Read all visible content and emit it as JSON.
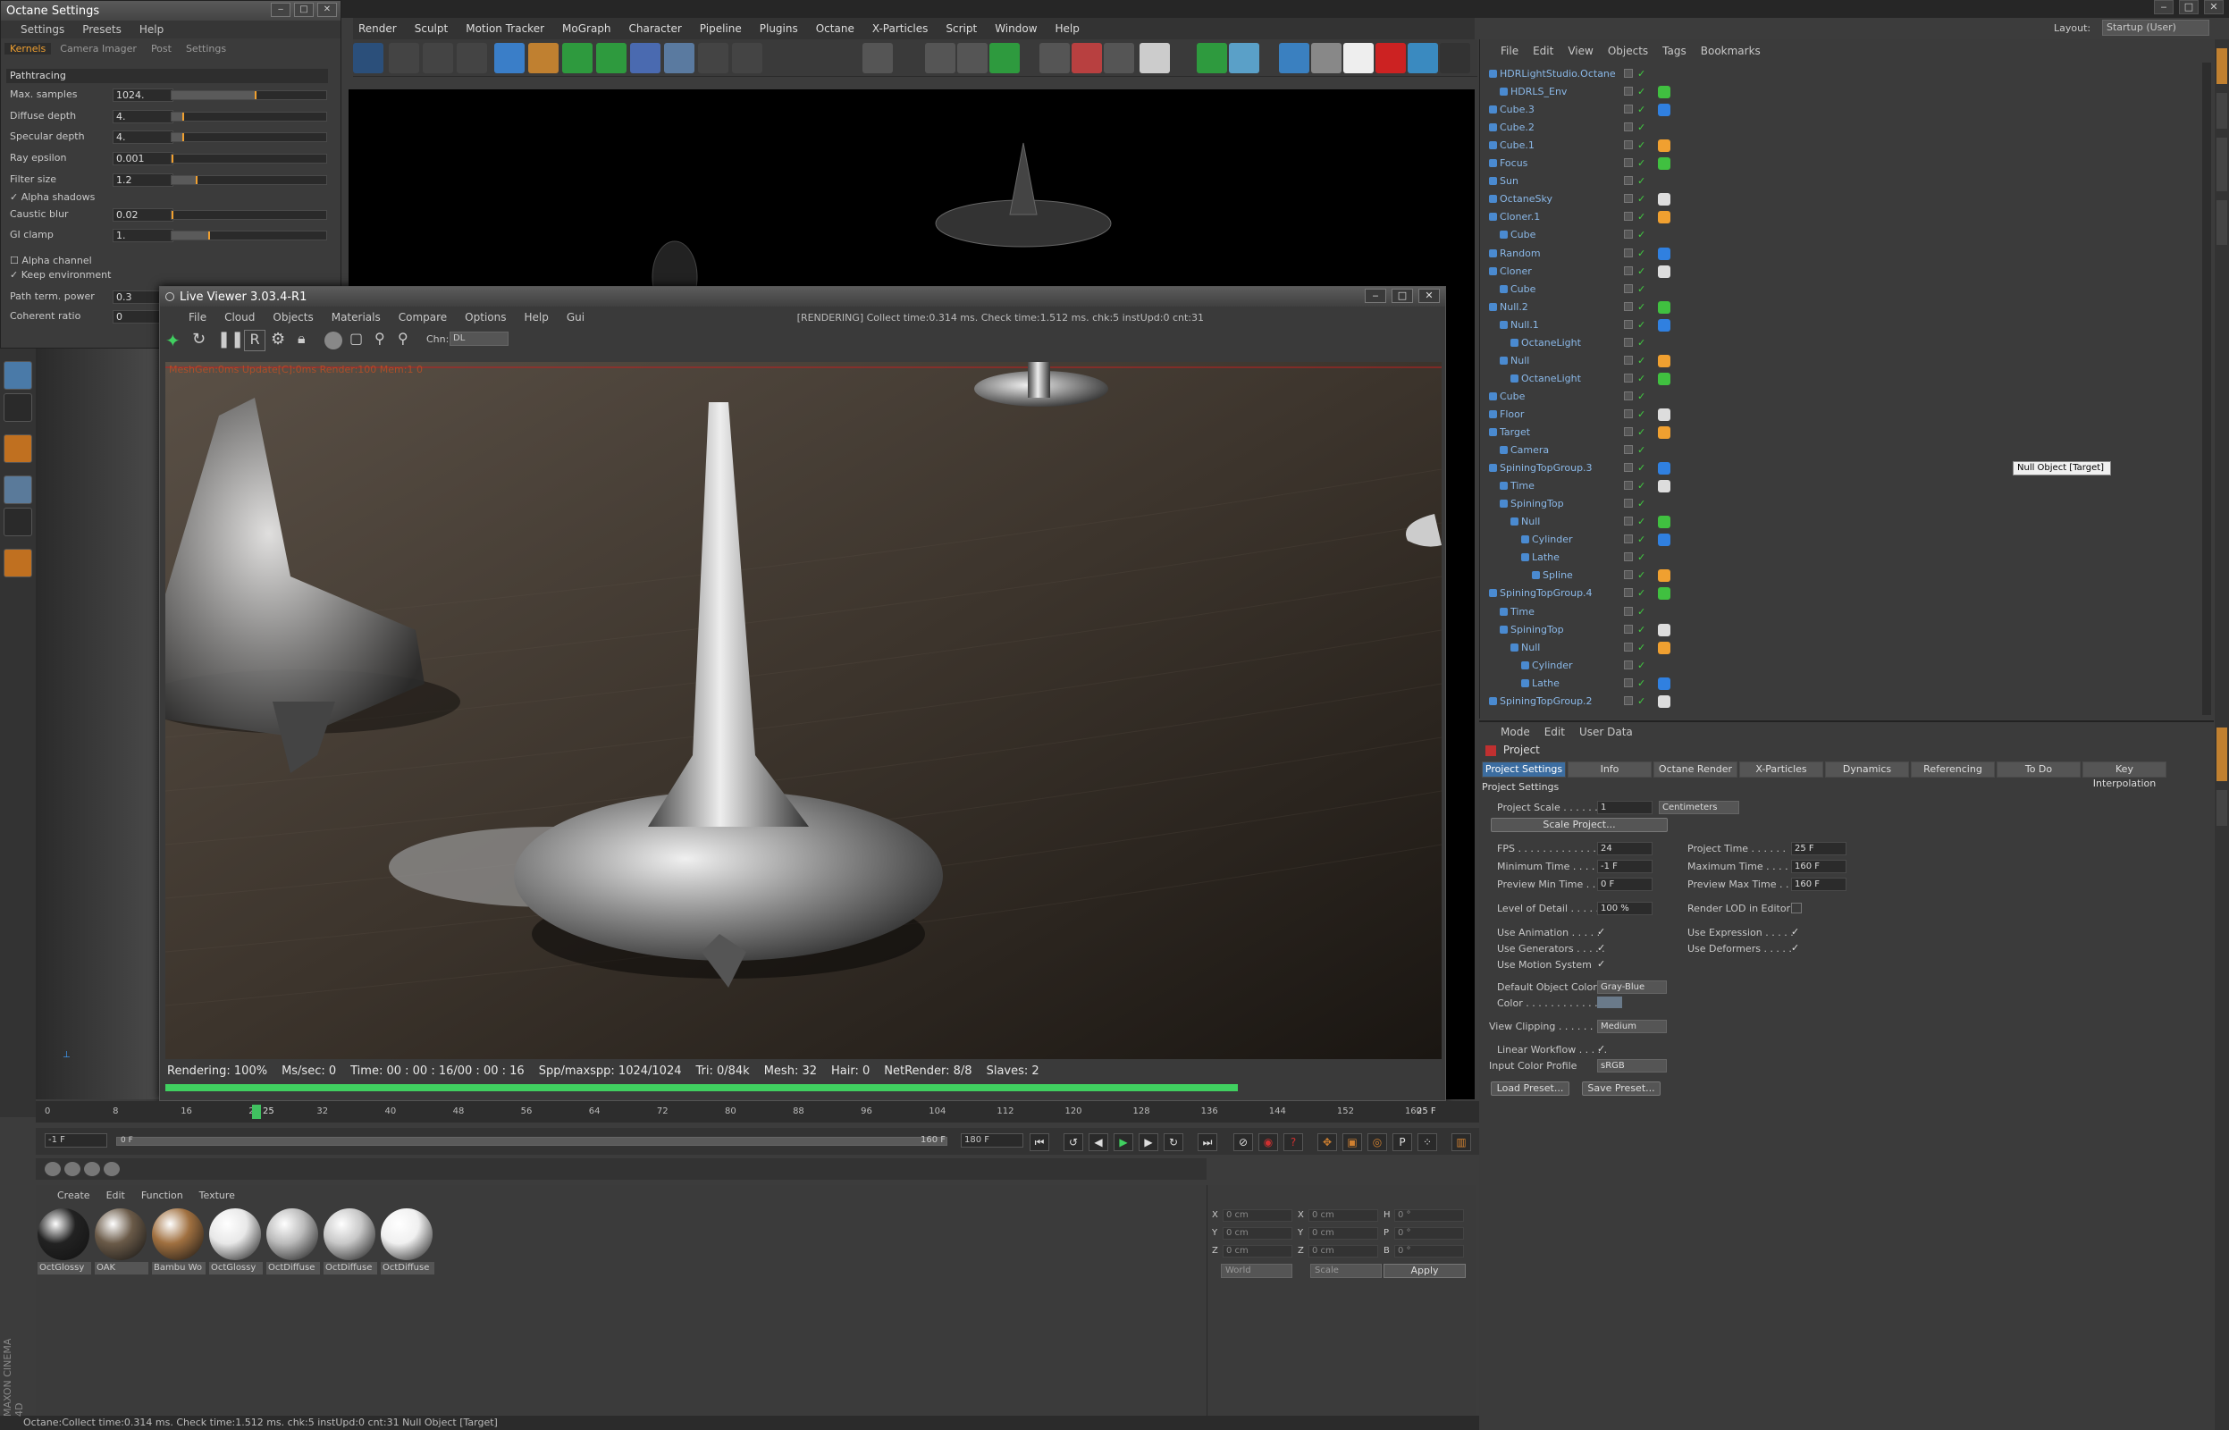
{
  "app": {
    "menu": [
      "Render",
      "Sculpt",
      "Motion Tracker",
      "MoGraph",
      "Character",
      "Pipeline",
      "Plugins",
      "Octane",
      "X-Particles",
      "Script",
      "Window",
      "Help"
    ],
    "layout_label": "Layout:",
    "layout_value": "Startup (User)",
    "status": "Octane:Collect time:0.314 ms.  Check time:1.512 ms.  chk:5  instUpd:0  cnt:31     Null Object [Target]",
    "brand": "MAXON CINEMA 4D"
  },
  "octane_settings": {
    "title": "Octane Settings",
    "menu": [
      "Settings",
      "Presets",
      "Help"
    ],
    "tabs": [
      "Kernels",
      "Camera Imager",
      "Post",
      "Settings"
    ],
    "mode": "Pathtracing",
    "params": [
      {
        "label": "Max. samples",
        "value": "1024.",
        "fill": 0.55
      },
      {
        "label": "Diffuse depth",
        "value": "4.",
        "fill": 0.08
      },
      {
        "label": "Specular depth",
        "value": "4.",
        "fill": 0.08
      },
      {
        "label": "Ray epsilon",
        "value": "0.001",
        "fill": 0.0
      },
      {
        "label": "Filter size",
        "value": "1.2",
        "fill": 0.17
      },
      {
        "label": "Caustic blur",
        "value": "0.02",
        "fill": 0.0
      },
      {
        "label": "GI clamp",
        "value": "1.",
        "fill": 0.25
      }
    ],
    "checks": [
      "Alpha shadows",
      "Alpha channel",
      "Keep environment"
    ],
    "path_term": {
      "label": "Path term. power",
      "value": "0.3"
    },
    "coherent": {
      "label": "Coherent ratio",
      "value": "0"
    }
  },
  "live_viewer": {
    "title": "Live Viewer 3.03.4-R1",
    "menu": [
      "File",
      "Cloud",
      "Objects",
      "Materials",
      "Compare",
      "Options",
      "Help",
      "Gui"
    ],
    "status": "[RENDERING] Collect time:0.314 ms.  Check time:1.512 ms.  chk:5  instUpd:0  cnt:31",
    "channel_label": "Chn:",
    "channel_value": "DL",
    "overlay": "MeshGen:0ms  Update[C]:0ms  Render:100  Mem:1  0",
    "stats": {
      "rendering": "Rendering: 100%",
      "mssec": "Ms/sec: 0",
      "time": "Time: 00 : 00 : 16/00 : 00 : 16",
      "spp": "Spp/maxspp: 1024/1024",
      "tri": "Tri: 0/84k",
      "mesh": "Mesh: 32",
      "hair": "Hair: 0",
      "netrender": "NetRender: 8/8",
      "slaves": "Slaves: 2"
    },
    "progress": 1.0
  },
  "timeline": {
    "ticks": [
      "0",
      "8",
      "16",
      "24",
      "32",
      "40",
      "48",
      "56",
      "64",
      "72",
      "80",
      "88",
      "96",
      "104",
      "112",
      "120",
      "128",
      "136",
      "144",
      "152",
      "160"
    ],
    "current_frame": "25",
    "frame_display": "25 F",
    "start_field": "-1 F",
    "range_start": "0 F",
    "range_end": "160 F",
    "end_field": "180 F"
  },
  "materials": {
    "menu": [
      "Create",
      "Edit",
      "Function",
      "Texture"
    ],
    "items": [
      {
        "name": "OctGlossy",
        "color": "#222"
      },
      {
        "name": "OAK",
        "color": "#6a5a48"
      },
      {
        "name": "Bambu Wo",
        "color": "#a07040"
      },
      {
        "name": "OctGlossy",
        "color": "#e8e8e8"
      },
      {
        "name": "OctDiffuse",
        "color": "#bbbbbb"
      },
      {
        "name": "OctDiffuse",
        "color": "#c8c8c8"
      },
      {
        "name": "OctDiffuse",
        "color": "#f0f0f0"
      }
    ]
  },
  "coords": {
    "rows": [
      {
        "a": "X",
        "av": "0 cm",
        "b": "X",
        "bv": "0 cm",
        "c": "H",
        "cv": "0 °"
      },
      {
        "a": "Y",
        "av": "0 cm",
        "b": "Y",
        "bv": "0 cm",
        "c": "P",
        "cv": "0 °"
      },
      {
        "a": "Z",
        "av": "0 cm",
        "b": "Z",
        "bv": "0 cm",
        "c": "B",
        "cv": "0 °"
      }
    ],
    "world": "World",
    "scale": "Scale",
    "apply": "Apply"
  },
  "object_manager": {
    "menu": [
      "File",
      "Edit",
      "View",
      "Objects",
      "Tags",
      "Bookmarks"
    ],
    "tooltip": "Null Object [Target]",
    "objects": [
      {
        "name": "HDRLightStudio.Octane",
        "depth": 0
      },
      {
        "name": "HDRLS_Env",
        "depth": 1
      },
      {
        "name": "Cube.3",
        "depth": 0
      },
      {
        "name": "Cube.2",
        "depth": 0
      },
      {
        "name": "Cube.1",
        "depth": 0
      },
      {
        "name": "Focus",
        "depth": 0
      },
      {
        "name": "Sun",
        "depth": 0
      },
      {
        "name": "OctaneSky",
        "depth": 0
      },
      {
        "name": "Cloner.1",
        "depth": 0
      },
      {
        "name": "Cube",
        "depth": 1
      },
      {
        "name": "Random",
        "depth": 0
      },
      {
        "name": "Cloner",
        "depth": 0
      },
      {
        "name": "Cube",
        "depth": 1
      },
      {
        "name": "Null.2",
        "depth": 0
      },
      {
        "name": "Null.1",
        "depth": 1
      },
      {
        "name": "OctaneLight",
        "depth": 2
      },
      {
        "name": "Null",
        "depth": 1
      },
      {
        "name": "OctaneLight",
        "depth": 2
      },
      {
        "name": "Cube",
        "depth": 0
      },
      {
        "name": "Floor",
        "depth": 0
      },
      {
        "name": "Target",
        "depth": 0
      },
      {
        "name": "Camera",
        "depth": 1
      },
      {
        "name": "SpiningTopGroup.3",
        "depth": 0
      },
      {
        "name": "Time",
        "depth": 1
      },
      {
        "name": "SpiningTop",
        "depth": 1
      },
      {
        "name": "Null",
        "depth": 2
      },
      {
        "name": "Cylinder",
        "depth": 3
      },
      {
        "name": "Lathe",
        "depth": 3
      },
      {
        "name": "Spline",
        "depth": 4
      },
      {
        "name": "SpiningTopGroup.4",
        "depth": 0
      },
      {
        "name": "Time",
        "depth": 1
      },
      {
        "name": "SpiningTop",
        "depth": 1
      },
      {
        "name": "Null",
        "depth": 2
      },
      {
        "name": "Cylinder",
        "depth": 3
      },
      {
        "name": "Lathe",
        "depth": 3
      },
      {
        "name": "SpiningTopGroup.2",
        "depth": 0
      }
    ]
  },
  "attributes": {
    "menu": [
      "Mode",
      "Edit",
      "User Data"
    ],
    "header": "Project",
    "tabs": [
      "Project Settings",
      "Info",
      "Octane Render",
      "X-Particles",
      "Dynamics",
      "Referencing",
      "To Do",
      "Key Interpolation"
    ],
    "section": "Project Settings",
    "project_scale": {
      "label": "Project Scale . . . . . .",
      "value": "1",
      "unit": "Centimeters"
    },
    "scale_project": "Scale Project...",
    "fps": {
      "label": "FPS . . . . . . . . . . . . .",
      "value": "24"
    },
    "project_time": {
      "label": "Project Time . . . . . .",
      "value": "25 F"
    },
    "min_time": {
      "label": "Minimum Time . . . . .",
      "value": "-1 F"
    },
    "max_time": {
      "label": "Maximum Time . . . . .",
      "value": "160 F"
    },
    "prev_min": {
      "label": "Preview Min Time . . .",
      "value": "0 F"
    },
    "prev_max": {
      "label": "Preview Max Time . . .",
      "value": "160 F"
    },
    "lod": {
      "label": "Level of Detail . . . . .",
      "value": "100 %"
    },
    "render_lod": "Render LOD in Editor",
    "use_animation": "Use Animation . . . . .",
    "use_expression": "Use Expression . . . . .",
    "use_generators": "Use Generators . . . . .",
    "use_deformers": "Use Deformers . . . . .",
    "use_motion": "Use Motion System",
    "default_color": {
      "label": "Default Object Color",
      "value": "Gray-Blue"
    },
    "color_label": "Color . . . . . . . . . . . .",
    "view_clipping": {
      "label": "View Clipping . . . . . .",
      "value": "Medium"
    },
    "linear_workflow": "Linear Workflow . . . . .",
    "input_profile": {
      "label": "Input Color Profile",
      "value": "sRGB"
    },
    "load_preset": "Load Preset...",
    "save_preset": "Save Preset..."
  }
}
